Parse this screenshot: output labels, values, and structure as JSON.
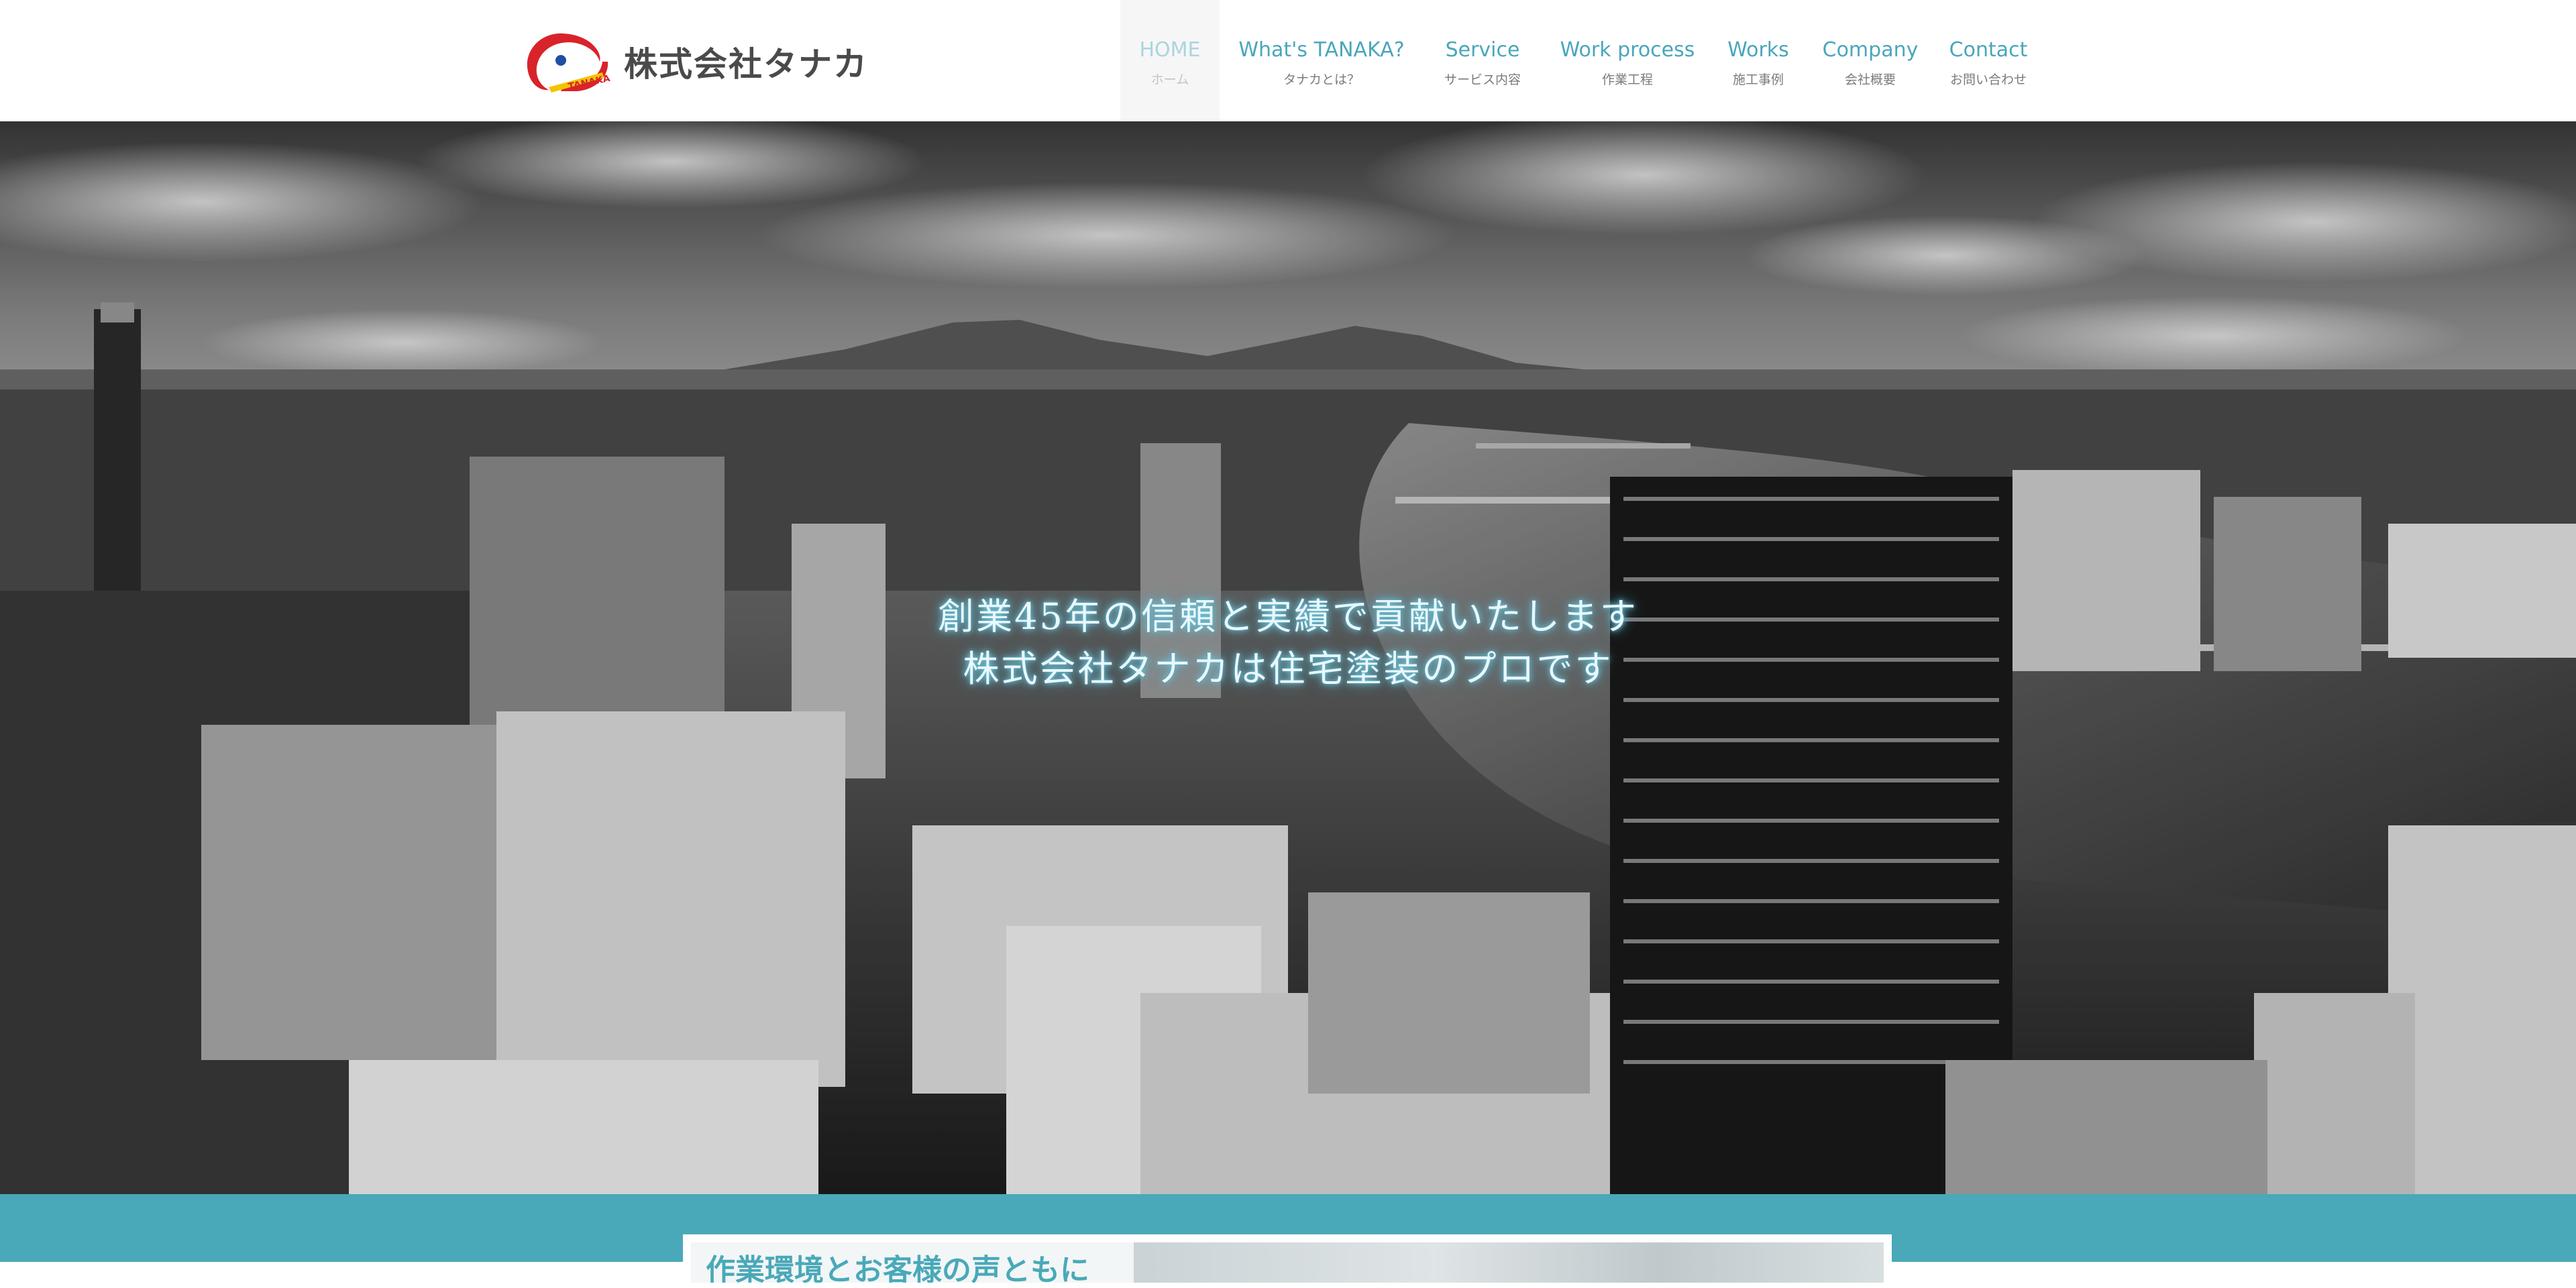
{
  "header": {
    "logo_text": "株式会社タナカ",
    "logo_mark_text": "TANAKA"
  },
  "nav": {
    "items": [
      {
        "en": "HOME",
        "jp": "ホーム",
        "active": true
      },
      {
        "en": "What's TANAKA?",
        "jp": "タナカとは？",
        "active": false
      },
      {
        "en": "Service",
        "jp": "サービス内容",
        "active": false
      },
      {
        "en": "Work process",
        "jp": "作業工程",
        "active": false
      },
      {
        "en": "Works",
        "jp": "施工事例",
        "active": false
      },
      {
        "en": "Company",
        "jp": "会社概要",
        "active": false
      },
      {
        "en": "Contact",
        "jp": "お問い合わせ",
        "active": false
      }
    ]
  },
  "hero": {
    "line1": "創業45年の信頼と実績で貢献いたします",
    "line2": "株式会社タナカは住宅塗装のプロです"
  },
  "feature": {
    "title": "作業環境とお客様の声ともに"
  },
  "colors": {
    "accent": "#49a9b9",
    "nav_text": "#4aa6bc",
    "logo_red": "#d9232a",
    "logo_blue": "#1e4fa3",
    "logo_yellow": "#f2c400"
  }
}
